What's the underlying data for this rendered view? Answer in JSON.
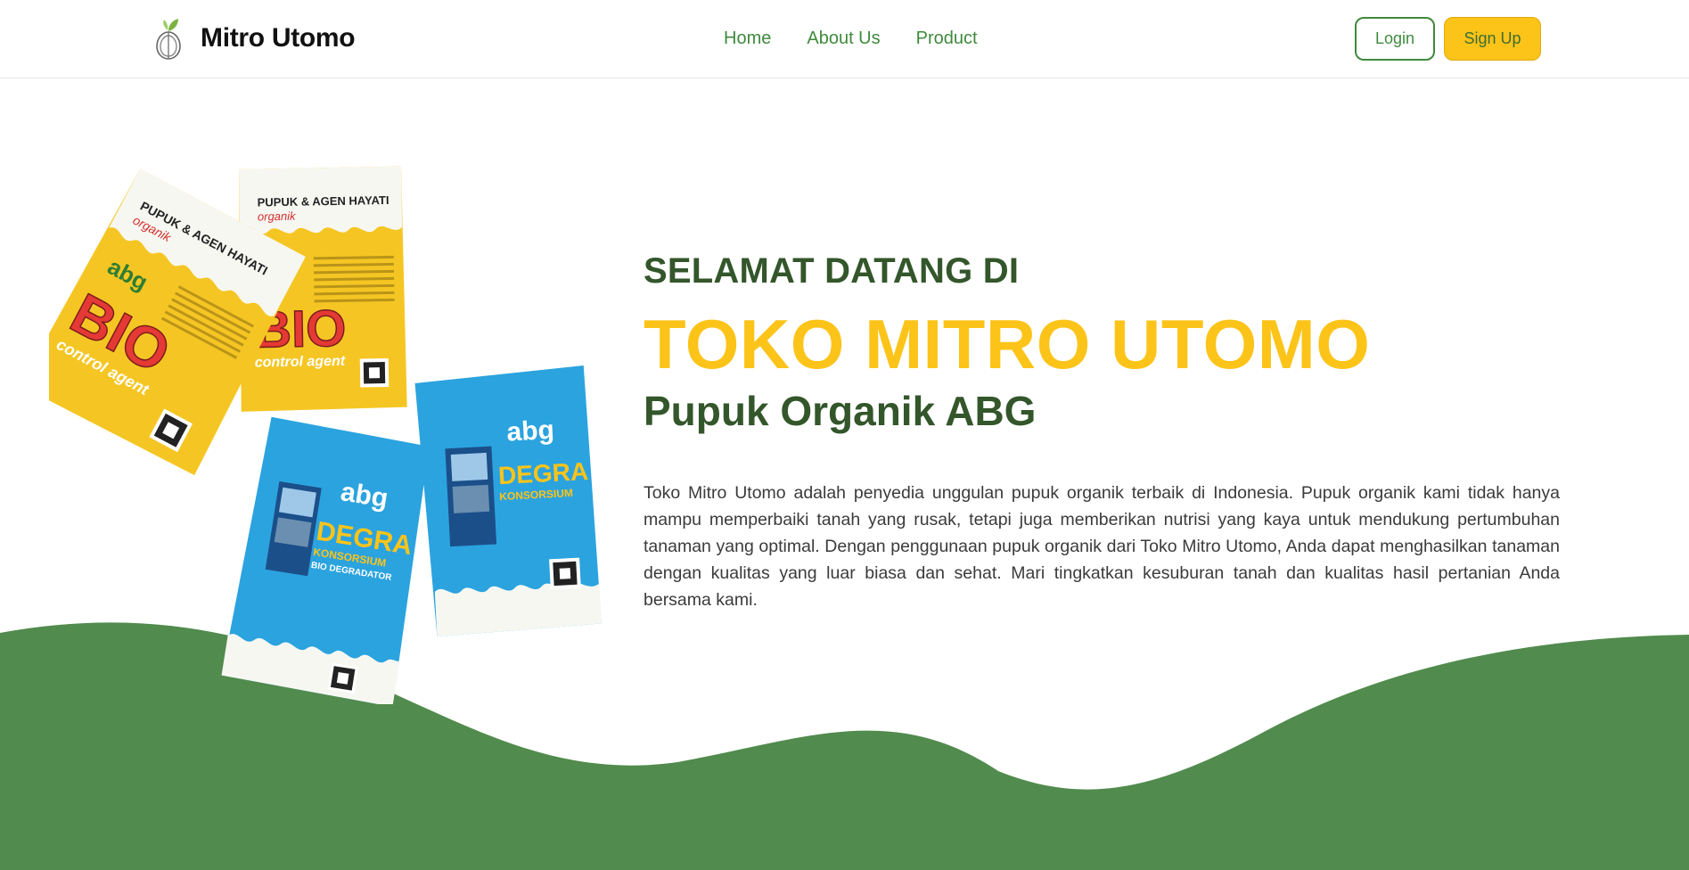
{
  "navbar": {
    "brand_name": "Mitro Utomo",
    "brand_logo_icon": "abg-leaf-logo-icon",
    "links": [
      {
        "label": "Home"
      },
      {
        "label": "About Us"
      },
      {
        "label": "Product"
      }
    ],
    "login_label": "Login",
    "signup_label": "Sign Up"
  },
  "hero": {
    "kicker": "SELAMAT DATANG DI",
    "title": "TOKO MITRO UTOMO",
    "subtitle": "Pupuk Organik ABG",
    "description": "Toko Mitro Utomo adalah penyedia unggulan pupuk organik terbaik di Indonesia. Pupuk organik kami tidak hanya mampu memperbaiki tanah yang rusak, tetapi juga memberikan nutrisi yang kaya untuk mendukung pertumbuhan tanaman yang optimal. Dengan penggunaan pupuk organik dari Toko Mitro Utomo, Anda dapat menghasilkan tanaman dengan kualitas yang luar biasa dan sehat. Mari tingkatkan kesuburan tanah dan kualitas hasil pertanian Anda bersama kami."
  },
  "product_image": {
    "yellow_pack_header": "PUPUK & AGEN HAYATI",
    "yellow_pack_sub": "organik",
    "yellow_pack_brand": "abg",
    "yellow_pack_name": "BIO",
    "yellow_pack_tag": "control agent",
    "blue_pack_brand": "abg",
    "blue_pack_name": "DEGRA",
    "blue_pack_tag": "KONSORSIUM",
    "blue_pack_tag2": "BIO DEGRADATOR"
  },
  "colors": {
    "primary_green": "#3f8a3c",
    "dark_green": "#33562b",
    "accent_yellow": "#fcc419",
    "wave_green": "#518b4d",
    "pack_yellow": "#f5c623",
    "pack_blue": "#2ba3df"
  }
}
